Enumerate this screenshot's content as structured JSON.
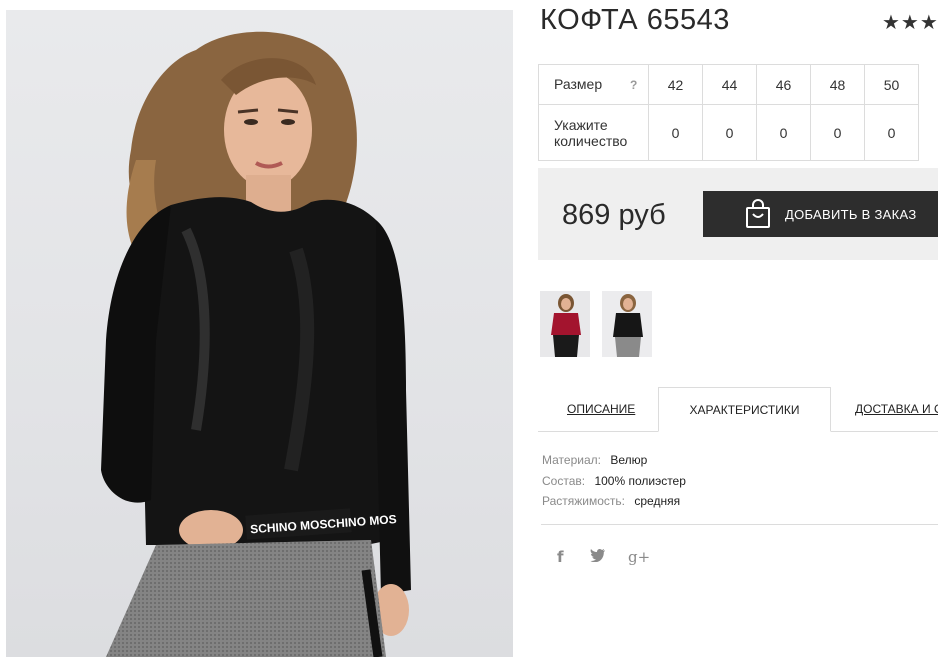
{
  "product": {
    "title": "КОФТА 65543",
    "rating_stars": "★★★"
  },
  "sizes": {
    "size_label": "Размер",
    "help": "?",
    "values": [
      "42",
      "44",
      "46",
      "48",
      "50"
    ],
    "qty_label_line1": "Укажите",
    "qty_label_line2": "количество",
    "quantities": [
      "0",
      "0",
      "0",
      "0",
      "0"
    ]
  },
  "purchase": {
    "price": "869 руб",
    "add_button": "ДОБАВИТЬ В ЗАКАЗ",
    "button_color": "#2d2d2d"
  },
  "thumbnails": [
    {
      "icon": "burgundy-top-thumbnail"
    },
    {
      "icon": "black-top-thumbnail"
    }
  ],
  "tabs": {
    "description": "ОПИСАНИЕ",
    "characteristics": "ХАРАКТЕРИСТИКИ",
    "delivery": "ДОСТАВКА И О"
  },
  "specs": [
    {
      "key": "Материал:",
      "value": "Велюр"
    },
    {
      "key": "Состав:",
      "value": "100% полиэстер"
    },
    {
      "key": "Растяжимость:",
      "value": "средняя"
    }
  ],
  "social": {
    "facebook": "f",
    "twitter": "🐦",
    "googleplus": "g+"
  },
  "photo": {
    "waistband_text": "SCHINO MOSCHINO MOS"
  }
}
